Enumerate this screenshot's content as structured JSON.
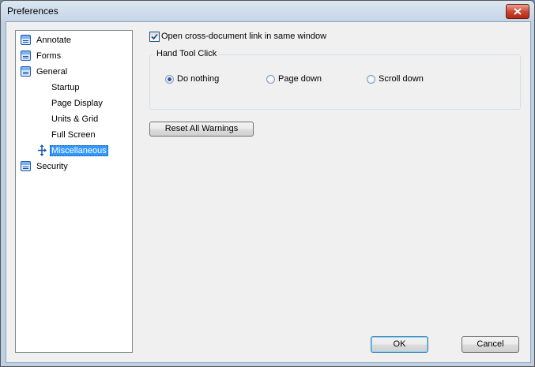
{
  "window": {
    "title": "Preferences"
  },
  "tree": {
    "items": [
      {
        "label": "Annotate",
        "level": 0,
        "icon": "page-icon"
      },
      {
        "label": "Forms",
        "level": 0,
        "icon": "page-icon"
      },
      {
        "label": "General",
        "level": 0,
        "icon": "page-icon"
      },
      {
        "label": "Startup",
        "level": 1
      },
      {
        "label": "Page Display",
        "level": 1
      },
      {
        "label": "Units & Grid",
        "level": 1
      },
      {
        "label": "Full Screen",
        "level": 1
      },
      {
        "label": "Miscellaneous",
        "level": 1,
        "selected": true,
        "icon": "move-arrows-icon"
      },
      {
        "label": "Security",
        "level": 0,
        "icon": "page-icon"
      }
    ]
  },
  "options": {
    "open_link_checkbox": {
      "label": "Open cross-document link in same window",
      "checked": true
    },
    "hand_tool": {
      "title": "Hand Tool Click",
      "choices": [
        {
          "label": "Do nothing",
          "selected": true
        },
        {
          "label": "Page down",
          "selected": false
        },
        {
          "label": "Scroll down",
          "selected": false
        }
      ]
    },
    "reset_warnings_label": "Reset All Warnings"
  },
  "footer": {
    "ok_label": "OK",
    "cancel_label": "Cancel"
  },
  "colors": {
    "selection": "#3399ff",
    "close_button": "#c7432d"
  }
}
